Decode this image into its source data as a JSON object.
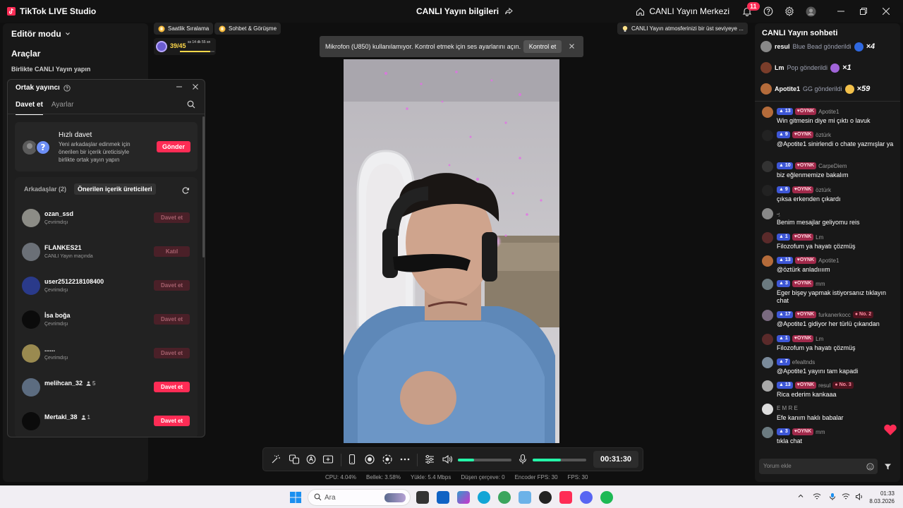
{
  "titlebar": {
    "app_name": "TikTok LIVE Studio",
    "stream_info": "CANLI Yayın bilgileri",
    "live_center": "CANLI Yayın Merkezi",
    "notification_count": "11"
  },
  "left_panel": {
    "editor_mode": "Editör modu",
    "tools_heading": "Araçlar",
    "cohost_label": "Birlikte CANLI Yayın yapın"
  },
  "cohost_popup": {
    "title": "Ortak yayıncı",
    "tabs": [
      "Davet et",
      "Ayarlar"
    ],
    "quick_invite": {
      "title": "Hızlı davet",
      "description": "Yeni arkadaşlar edinmek için önerilen bir içerik üreticisiyle birlikte ortak yayın yapın",
      "button": "Gönder"
    },
    "subtabs": [
      "Arkadaşlar (2)",
      "Önerilen içerik üreticileri"
    ],
    "creators": [
      {
        "name": "ozan_ssd",
        "status": "Çevrimdışı",
        "button": "Davet et",
        "count": "",
        "enabled": false
      },
      {
        "name": "FLANKES21",
        "status": "CANLI Yayın maçında",
        "button": "Katıl",
        "count": "",
        "enabled": false
      },
      {
        "name": "user2512218108400",
        "status": "Çevrimdışı",
        "button": "Davet et",
        "count": "",
        "enabled": false
      },
      {
        "name": "İsa boğa",
        "status": "Çevrimdışı",
        "button": "Davet et",
        "count": "",
        "enabled": false
      },
      {
        "name": "......",
        "status": "Çevrimdışı",
        "button": "Davet et",
        "count": "",
        "enabled": false
      },
      {
        "name": "melihcan_32",
        "status": "",
        "button": "Davet et",
        "count": "5",
        "enabled": true
      },
      {
        "name": "Mertakl_38",
        "status": "",
        "button": "Davet et",
        "count": "1",
        "enabled": true
      }
    ]
  },
  "top_chips": {
    "hourly_ranking": "Saatlik Sıralama",
    "chat_meet": "Sohbet & Görüşme",
    "atmosphere_tip": "CANLI Yayın atmosferinizi bir üst seviyeye ..."
  },
  "level_widget": {
    "value": "39/45",
    "time": "ss 14 dk 55 sn",
    "progress": 0.87
  },
  "mic_toast": {
    "text": "Mikrofon (U850) kullanılamıyor. Kontrol etmek için ses ayarlarını açın.",
    "button": "Kontrol et"
  },
  "control_bar": {
    "timer": "00:31:30",
    "speaker_level": 0.3,
    "mic_level": 0.52
  },
  "stats": {
    "cpu": "CPU:  4.04%",
    "memory": "Bellek:  3.58%",
    "upload": "Yükle:  5.4 Mbps",
    "dropped": "Düşen çerçeve:  0",
    "encoder_fps": "Encoder FPS:  30",
    "fps": "FPS:  30"
  },
  "chat": {
    "title": "CANLI Yayın sohbeti",
    "gifts": [
      {
        "user": "resul",
        "text": "Blue Bead gönderildi",
        "count": "×4"
      },
      {
        "user": "Lm",
        "text": "Pop gönderildi",
        "count": "×1"
      },
      {
        "user": "Apotite1",
        "text": "GG gönderildi",
        "count": "×59"
      }
    ],
    "messages": [
      {
        "level": "13",
        "team": "OYNK",
        "user": "Apotite1",
        "rank": "",
        "text": "Win gitmesin diye mi çıktı o lavuk"
      },
      {
        "level": "9",
        "team": "OYNK",
        "user": "öztürk",
        "rank": "",
        "text": "@Apotite1 sinirlendi o chate yazmışlar ya"
      },
      {
        "level": "10",
        "team": "OYNK",
        "user": "CarpeDiem",
        "rank": "",
        "text": "biz eğlenmemize bakalım"
      },
      {
        "level": "9",
        "team": "OYNK",
        "user": "öztürk",
        "rank": "",
        "text": "çıksa erkenden çıkardı"
      },
      {
        "level": "",
        "team": "",
        "user": "بِـ",
        "rank": "",
        "text": "Benim mesajlar geliyomu reis"
      },
      {
        "level": "1",
        "team": "OYNK",
        "user": "Lm",
        "rank": "",
        "text": "Filozofum ya hayatı çözmüş"
      },
      {
        "level": "13",
        "team": "OYNK",
        "user": "Apotite1",
        "rank": "",
        "text": "@öztürk anladıııım"
      },
      {
        "level": "3",
        "team": "OYNK",
        "user": "mm",
        "rank": "",
        "text": "Eger bişey yapmak istiyorsanız tıklayın chat"
      },
      {
        "level": "17",
        "team": "OYNK",
        "user": "furkanerkocc",
        "rank": "No. 2",
        "text": "@Apotite1 gidiyor her türlü çıkandan"
      },
      {
        "level": "1",
        "team": "OYNK",
        "user": "Lm",
        "rank": "",
        "text": "Filozofum ya hayatı çözmüş"
      },
      {
        "level": "7",
        "team": "",
        "user": "efealtnds",
        "rank": "",
        "text": "@Apotite1 yayını tam kapadi"
      },
      {
        "level": "13",
        "team": "OYNK",
        "user": "resul",
        "rank": "No. 3",
        "text": "Rica ederim kankaaa"
      },
      {
        "level": "",
        "team": "",
        "user": "E M R E",
        "rank": "",
        "text": "Efe kanım haklı babalar"
      },
      {
        "level": "3",
        "team": "OYNK",
        "user": "mm",
        "rank": "",
        "text": "tıkla chat"
      }
    ],
    "input_placeholder": "Yorum ekle"
  },
  "taskbar": {
    "search_placeholder": "Ara",
    "time": "01:33",
    "date": "8.03.2026"
  }
}
